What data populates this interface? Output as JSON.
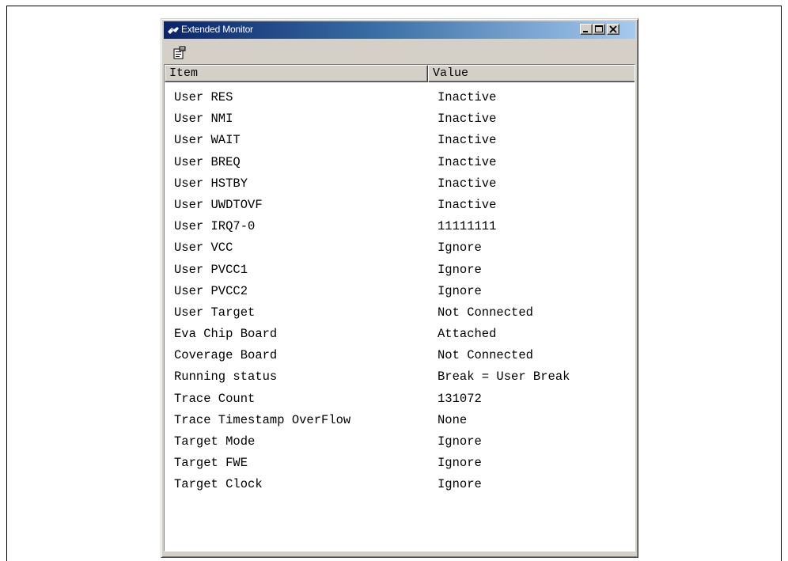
{
  "window": {
    "title": "Extended Monitor",
    "title_icon": "monitor-app-icon",
    "buttons": {
      "minimize": "minimize-icon",
      "maximize": "maximize-icon",
      "close": "close-icon"
    }
  },
  "toolbar": {
    "properties_icon": "properties-icon"
  },
  "table": {
    "columns": [
      "Item",
      "Value"
    ],
    "rows": [
      {
        "item": "User RES",
        "value": "Inactive"
      },
      {
        "item": "User NMI",
        "value": "Inactive"
      },
      {
        "item": "User WAIT",
        "value": "Inactive"
      },
      {
        "item": "User BREQ",
        "value": "Inactive"
      },
      {
        "item": "User HSTBY",
        "value": "Inactive"
      },
      {
        "item": "User UWDTOVF",
        "value": "Inactive"
      },
      {
        "item": "User IRQ7-0",
        "value": "11111111"
      },
      {
        "item": "User VCC",
        "value": "Ignore"
      },
      {
        "item": "User PVCC1",
        "value": "Ignore"
      },
      {
        "item": "User PVCC2",
        "value": "Ignore"
      },
      {
        "item": "User Target",
        "value": "Not Connected"
      },
      {
        "item": "Eva Chip Board",
        "value": "Attached"
      },
      {
        "item": "Coverage Board",
        "value": "Not Connected"
      },
      {
        "item": "Running status",
        "value": "Break = User Break"
      },
      {
        "item": "Trace Count",
        "value": "131072"
      },
      {
        "item": "Trace Timestamp OverFlow",
        "value": "None"
      },
      {
        "item": "Target Mode",
        "value": "Ignore"
      },
      {
        "item": "Target FWE",
        "value": "Ignore"
      },
      {
        "item": "Target Clock",
        "value": "Ignore"
      }
    ]
  },
  "colors": {
    "titlebar_start": "#0a246a",
    "titlebar_end": "#a6caf0",
    "face": "#d4d0c8"
  }
}
